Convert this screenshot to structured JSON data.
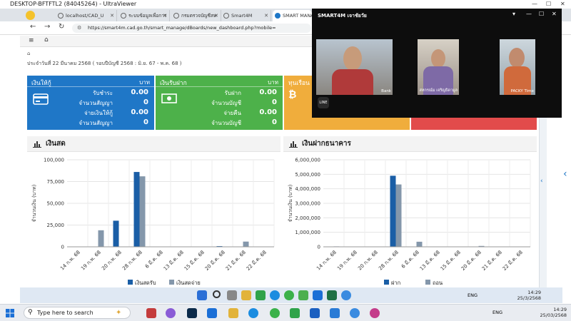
{
  "remote_title": "DESKTOP-BFTFTL2 (84045264) - UltraViewer",
  "tabs": [
    {
      "label": "localhost/CAD_U"
    },
    {
      "label": "ระบบข้อมูลเพื่อการ"
    },
    {
      "label": "กรมตรวจบัญชีสห"
    },
    {
      "label": "Smart4M"
    },
    {
      "label": "SMART MANAG"
    }
  ],
  "url": "https://smart4m.cad.go.th/smart_manage/dBoards/new_dashboard.php?mobile=",
  "app": {
    "report_date": "ประจำวันที่ 22 มีนาคม 2568 ( รอบปีบัญชี 2568 : มิ.ย. 67 - พ.ค. 68 )"
  },
  "cards": [
    {
      "title": "เงินให้กู้",
      "unit": "บาท",
      "icon": "credit-card-icon",
      "color": "#1f77c7",
      "rows": [
        {
          "label": "รับชำระ",
          "value": "0.00"
        },
        {
          "label": "จำนวนสัญญา",
          "value": "0"
        },
        {
          "label": "จ่ายเงินให้กู้",
          "value": "0.00"
        },
        {
          "label": "จำนวนสัญญา",
          "value": "0"
        }
      ]
    },
    {
      "title": "เงินรับฝาก",
      "unit": "บาท",
      "icon": "money-bill-icon",
      "color": "#4db14a",
      "rows": [
        {
          "label": "รับฝาก",
          "value": "0.00"
        },
        {
          "label": "จำนวนบัญชี",
          "value": "0"
        },
        {
          "label": "จ่ายคืน",
          "value": "0.00"
        },
        {
          "label": "จำนวนบัญชี",
          "value": "0"
        }
      ]
    },
    {
      "title": "ทุนเรือน",
      "unit": "",
      "icon": "bitcoin-icon",
      "color": "#f0ad3c",
      "rows": []
    },
    {
      "title": "",
      "unit": "",
      "icon": "",
      "color": "#e24b4b",
      "rows": []
    }
  ],
  "video_call": {
    "title": "SMART4M เจาชัยวัย",
    "participants": [
      {
        "name": "Bank"
      },
      {
        "name": "สหกรณ์ม เจริญธิดามูล"
      },
      {
        "name": "PACKY Time"
      }
    ]
  },
  "chart_data": [
    {
      "type": "bar",
      "title": "เงินสด",
      "ylabel": "จำนวนเงิน (บาท)",
      "ylim": [
        0,
        100000
      ],
      "yticks": [
        "0",
        "25,000",
        "50,000",
        "75,000",
        "100,000"
      ],
      "categories": [
        "14 ก.พ. 68",
        "19 ก.พ. 68",
        "20 ก.พ. 68",
        "28 ก.พ. 68",
        "6 มี.ค. 68",
        "13 มี.ค. 68",
        "15 มี.ค. 68",
        "20 มี.ค. 68",
        "21 มี.ค. 68",
        "22 มี.ค. 68"
      ],
      "series": [
        {
          "name": "เงินสดรับ",
          "color": "#1a5ea6",
          "values": [
            0,
            0,
            30000,
            86000,
            0,
            0,
            0,
            800,
            0,
            0
          ]
        },
        {
          "name": "เงินสดจ่าย",
          "color": "#8497ab",
          "values": [
            0,
            19000,
            0,
            81000,
            0,
            0,
            0,
            0,
            6000,
            0
          ]
        }
      ]
    },
    {
      "type": "bar",
      "title": "เงินฝากธนาคาร",
      "ylabel": "จำนวนเงิน (บาท)",
      "ylim": [
        0,
        6000000
      ],
      "yticks": [
        "0",
        "1,000,000",
        "2,000,000",
        "3,000,000",
        "4,000,000",
        "5,000,000",
        "6,000,000"
      ],
      "categories": [
        "14 ก.พ. 68",
        "19 ก.พ. 68",
        "20 ก.พ. 68",
        "28 ก.พ. 68",
        "6 มี.ค. 68",
        "13 มี.ค. 68",
        "15 มี.ค. 68",
        "20 มี.ค. 68",
        "21 มี.ค. 68",
        "22 มี.ค. 68"
      ],
      "series": [
        {
          "name": "ฝาก",
          "color": "#1a5ea6",
          "values": [
            0,
            0,
            0,
            4900000,
            0,
            0,
            0,
            0,
            0,
            0
          ]
        },
        {
          "name": "ถอน",
          "color": "#8497ab",
          "values": [
            30000,
            0,
            0,
            4300000,
            350000,
            0,
            0,
            60000,
            0,
            0
          ]
        }
      ]
    }
  ],
  "taskbar": {
    "search_placeholder": "Type here to search",
    "lang": "ENG",
    "time": "14:29",
    "date": "25/03/2568"
  },
  "inner_taskbar": {
    "lang": "ENG",
    "time": "14:29",
    "date": "25/3/2568"
  }
}
